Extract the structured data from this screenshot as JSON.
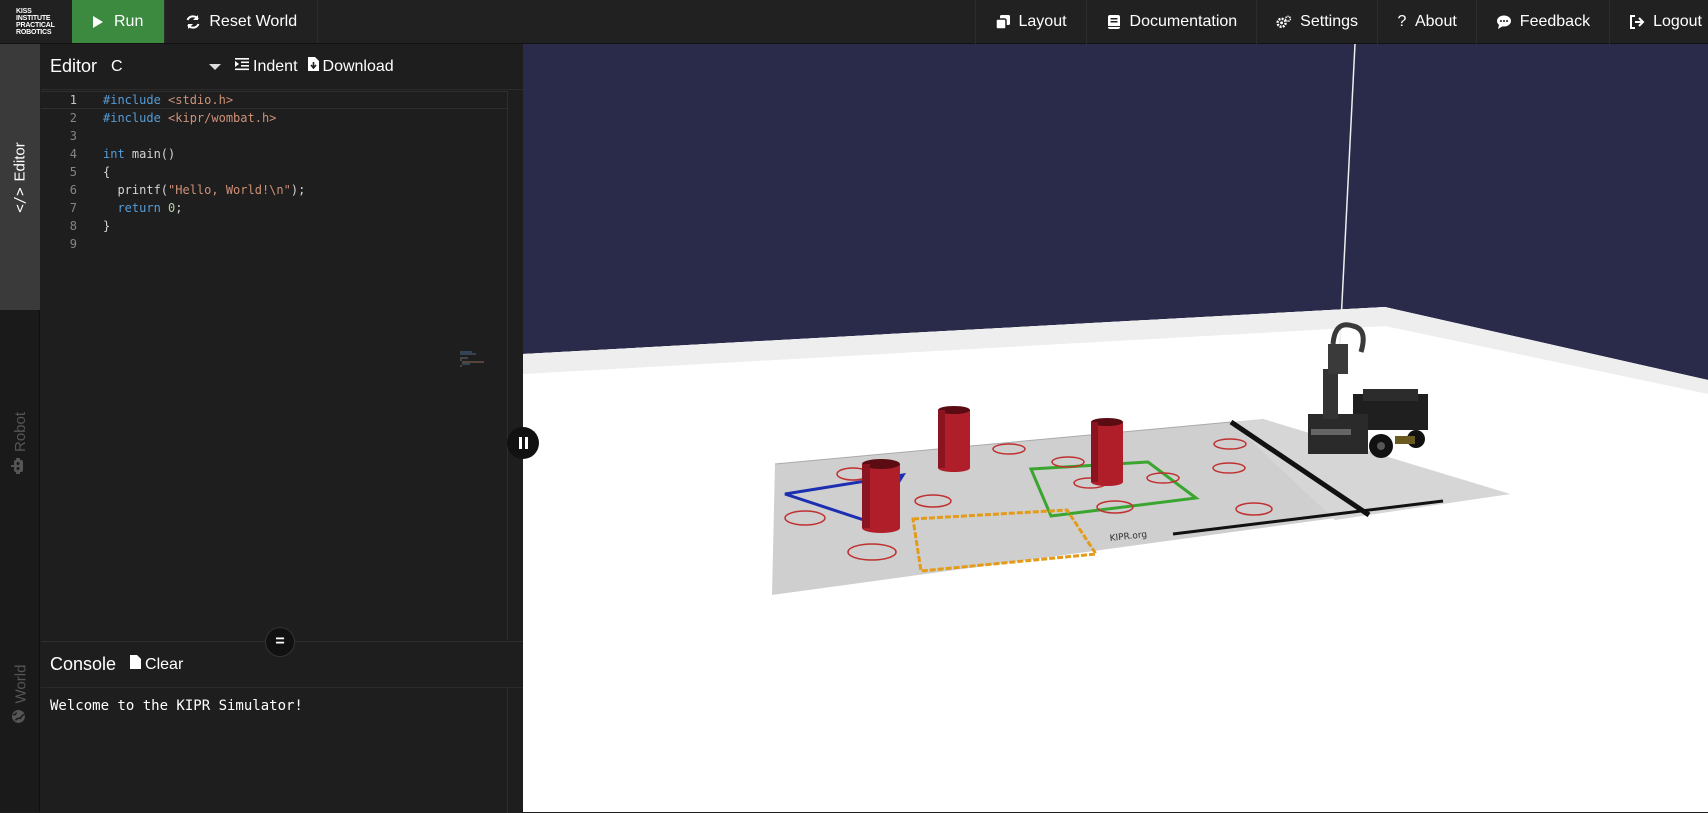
{
  "logo": {
    "text": "KISS INSTITUTE PRACTICAL ROBOTICS"
  },
  "toolbar": {
    "run_label": "Run",
    "reset_label": "Reset World",
    "layout_label": "Layout",
    "documentation_label": "Documentation",
    "settings_label": "Settings",
    "about_label": "About",
    "feedback_label": "Feedback",
    "logout_label": "Logout"
  },
  "sidebar_tabs": {
    "editor": "Editor",
    "robot": "Robot",
    "world": "World"
  },
  "editor": {
    "title": "Editor",
    "language": "C",
    "indent_label": "Indent",
    "download_label": "Download",
    "lines": [
      {
        "n": "1",
        "text": "#include <stdio.h>"
      },
      {
        "n": "2",
        "text": "#include <kipr/wombat.h>"
      },
      {
        "n": "3",
        "text": ""
      },
      {
        "n": "4",
        "text": "int main()"
      },
      {
        "n": "5",
        "text": "{"
      },
      {
        "n": "6",
        "text": "  printf(\"Hello, World!\\n\");"
      },
      {
        "n": "7",
        "text": "  return 0;"
      },
      {
        "n": "8",
        "text": "}"
      },
      {
        "n": "9",
        "text": ""
      }
    ]
  },
  "console": {
    "title": "Console",
    "clear_label": "Clear",
    "output": "Welcome to the KIPR Simulator!"
  },
  "scene": {
    "mat_text": "KIPR.org",
    "colors": {
      "sky": "#2a2b4a",
      "floor": "#ffffff",
      "mat": "#cfcfcf",
      "can": "#b01e2a",
      "blue_zone": "#1b2fb0",
      "green_zone": "#3aa52f",
      "orange_zone": "#e39b1a"
    }
  }
}
